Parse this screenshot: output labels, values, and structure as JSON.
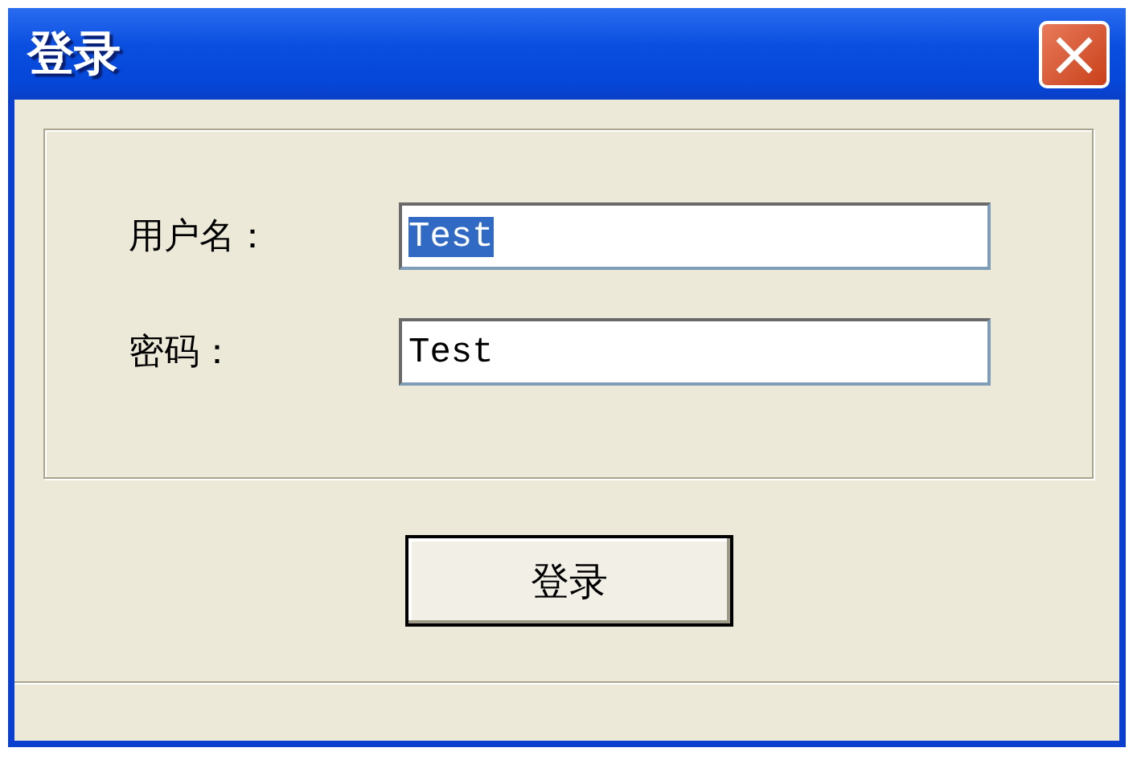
{
  "window": {
    "title": "登录",
    "close_button": "×"
  },
  "fields": [
    {
      "label": "用户名：",
      "value": "Test",
      "text_selected": true
    },
    {
      "label": "密码：",
      "value": "Test",
      "text_selected": false
    }
  ],
  "buttons": [
    "登录"
  ]
}
